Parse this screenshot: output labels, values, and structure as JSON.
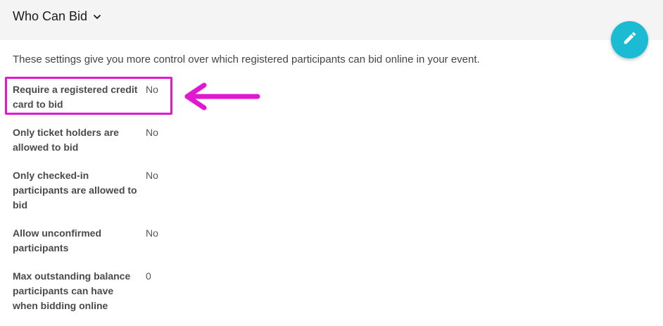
{
  "header": {
    "title": "Who Can Bid"
  },
  "description": "These settings give you more control over which registered participants can bid online in your event.",
  "settings": [
    {
      "label": "Require a registered credit card to bid",
      "value": "No"
    },
    {
      "label": "Only ticket holders are allowed to bid",
      "value": "No"
    },
    {
      "label": "Only checked-in participants are allowed to bid",
      "value": "No"
    },
    {
      "label": "Allow unconfirmed participants",
      "value": "No"
    },
    {
      "label": "Max outstanding balance participants can have when bidding online",
      "value": "0"
    }
  ],
  "icons": {
    "title_dropdown": "chevron-down-icon",
    "edit": "pencil-icon",
    "annotation_arrow": "arrow-left-icon"
  },
  "colors": {
    "header_bg": "#f4f4f4",
    "edit_button": "#1bbcd3",
    "annotation": "#e018d0"
  }
}
